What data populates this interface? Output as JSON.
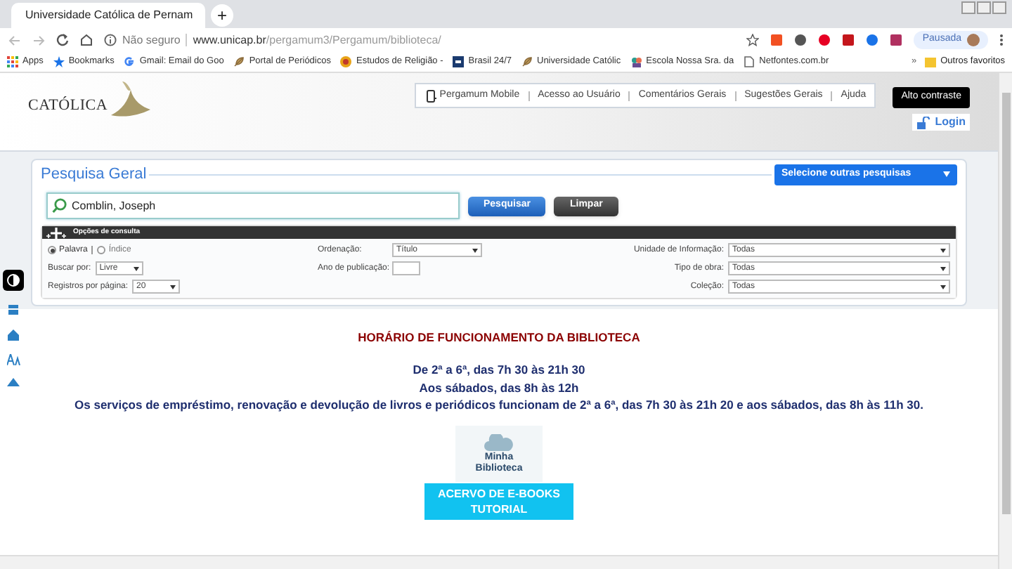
{
  "browser": {
    "tab_title": "Universidade Católica de Pernam",
    "new_tab": "+",
    "security": "Não seguro",
    "url_host": "www.unicap.br",
    "url_path": "/pergamum3/Pergamum/biblioteca/",
    "profile": "Pausada",
    "bookmarks": [
      {
        "label": "Apps",
        "kind": "apps"
      },
      {
        "label": "Bookmarks",
        "kind": "star"
      },
      {
        "label": "Gmail: Email do Goo",
        "kind": "google"
      },
      {
        "label": "Portal de Periódicos",
        "kind": "leaf"
      },
      {
        "label": "Estudos de Religião -",
        "kind": "badge"
      },
      {
        "label": "Brasil 24/7",
        "kind": "square"
      },
      {
        "label": "Universidade Católic",
        "kind": "leaf"
      },
      {
        "label": "Escola Nossa Sra. da",
        "kind": "people"
      },
      {
        "label": "Netfontes.com.br",
        "kind": "page"
      }
    ],
    "more": "»",
    "other_bookmarks": "Outros favoritos"
  },
  "header": {
    "logo": "CATÓLICA",
    "links": [
      {
        "label": "Pergamum Mobile",
        "kind": "mobile"
      },
      {
        "label": "Acesso ao Usuário",
        "kind": "plain"
      },
      {
        "label": "Comentários Gerais",
        "kind": "plain"
      },
      {
        "label": "Sugestões Gerais",
        "kind": "plain"
      },
      {
        "label": "Ajuda",
        "kind": "plain"
      }
    ],
    "contrast_button": "Alto contraste",
    "login": "Login"
  },
  "search": {
    "title": "Pesquisa Geral",
    "other_searches": "Selecione outras pesquisas",
    "query": "Comblin, Joseph",
    "buttons": [
      {
        "label": "Pesquisar",
        "kind": "primary"
      },
      {
        "label": "Limpar",
        "kind": "secondary"
      }
    ]
  },
  "options": {
    "title": "Opções de consulta",
    "modes": [
      {
        "label": "Palavra",
        "selected": true
      },
      {
        "label": "Índice",
        "selected": false
      }
    ],
    "left": [
      {
        "label": "Buscar por:",
        "value": "Livre"
      },
      {
        "label": "Registros por página:",
        "value": "20"
      }
    ],
    "middle": [
      {
        "label": "Ordenação:",
        "value": "Título",
        "kind": "select"
      },
      {
        "label": "Ano de publicação:",
        "kind": "text"
      }
    ],
    "right": [
      {
        "label": "Unidade de Informação:",
        "value": "Todas"
      },
      {
        "label": "Tipo de obra:",
        "value": "Todas"
      },
      {
        "label": "Coleção:",
        "value": "Todas"
      }
    ]
  },
  "notice": {
    "title": "HORÁRIO DE FUNCIONAMENTO DA BIBLIOTECA",
    "lines": [
      "De 2ª a 6ª, das 7h 30 às 21h 30",
      "Aos sábados, das 8h às 12h",
      "Os serviços de empréstimo, renovação e devolução de livros e periódicos funcionam de 2ª a 6ª, das 7h 30 às 21h 20 e aos sábados, das 8h às 11h 30."
    ]
  },
  "ebooks": {
    "logo": "Minha Biblioteca",
    "button_lines": [
      "ACERVO DE E-BOOKS",
      "TUTORIAL"
    ]
  }
}
